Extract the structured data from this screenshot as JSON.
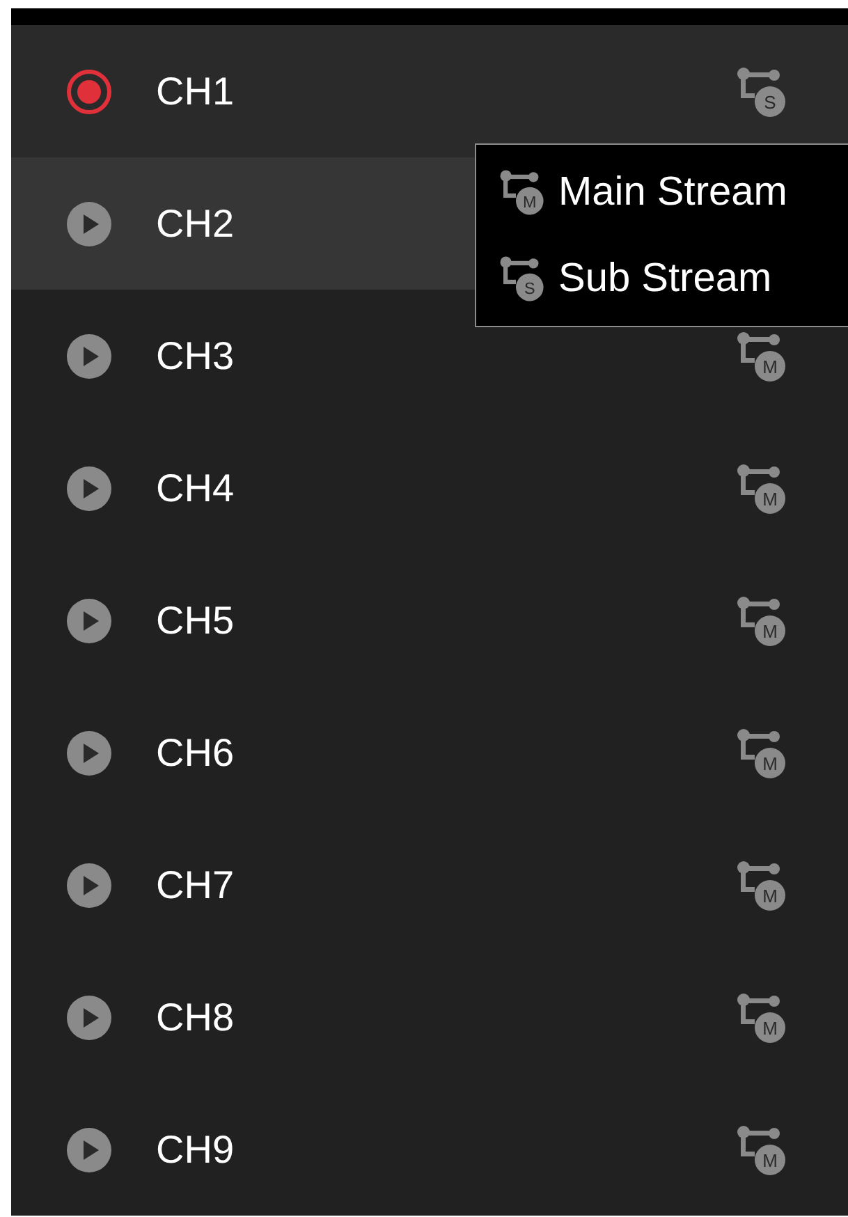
{
  "channels": [
    {
      "name": "CH1",
      "kind": "record",
      "selected": false,
      "stream_letter": "S"
    },
    {
      "name": "CH2",
      "kind": "play",
      "selected": true
    },
    {
      "name": "CH3",
      "kind": "play",
      "selected": false,
      "stream_letter": "M"
    },
    {
      "name": "CH4",
      "kind": "play",
      "selected": false,
      "stream_letter": "M"
    },
    {
      "name": "CH5",
      "kind": "play",
      "selected": false,
      "stream_letter": "M"
    },
    {
      "name": "CH6",
      "kind": "play",
      "selected": false,
      "stream_letter": "M"
    },
    {
      "name": "CH7",
      "kind": "play",
      "selected": false,
      "stream_letter": "M"
    },
    {
      "name": "CH8",
      "kind": "play",
      "selected": false,
      "stream_letter": "M"
    },
    {
      "name": "CH9",
      "kind": "play",
      "selected": false,
      "stream_letter": "M"
    }
  ],
  "stream_menu": [
    {
      "label": "Main Stream",
      "letter": "M"
    },
    {
      "label": "Sub Stream",
      "letter": "S"
    }
  ]
}
